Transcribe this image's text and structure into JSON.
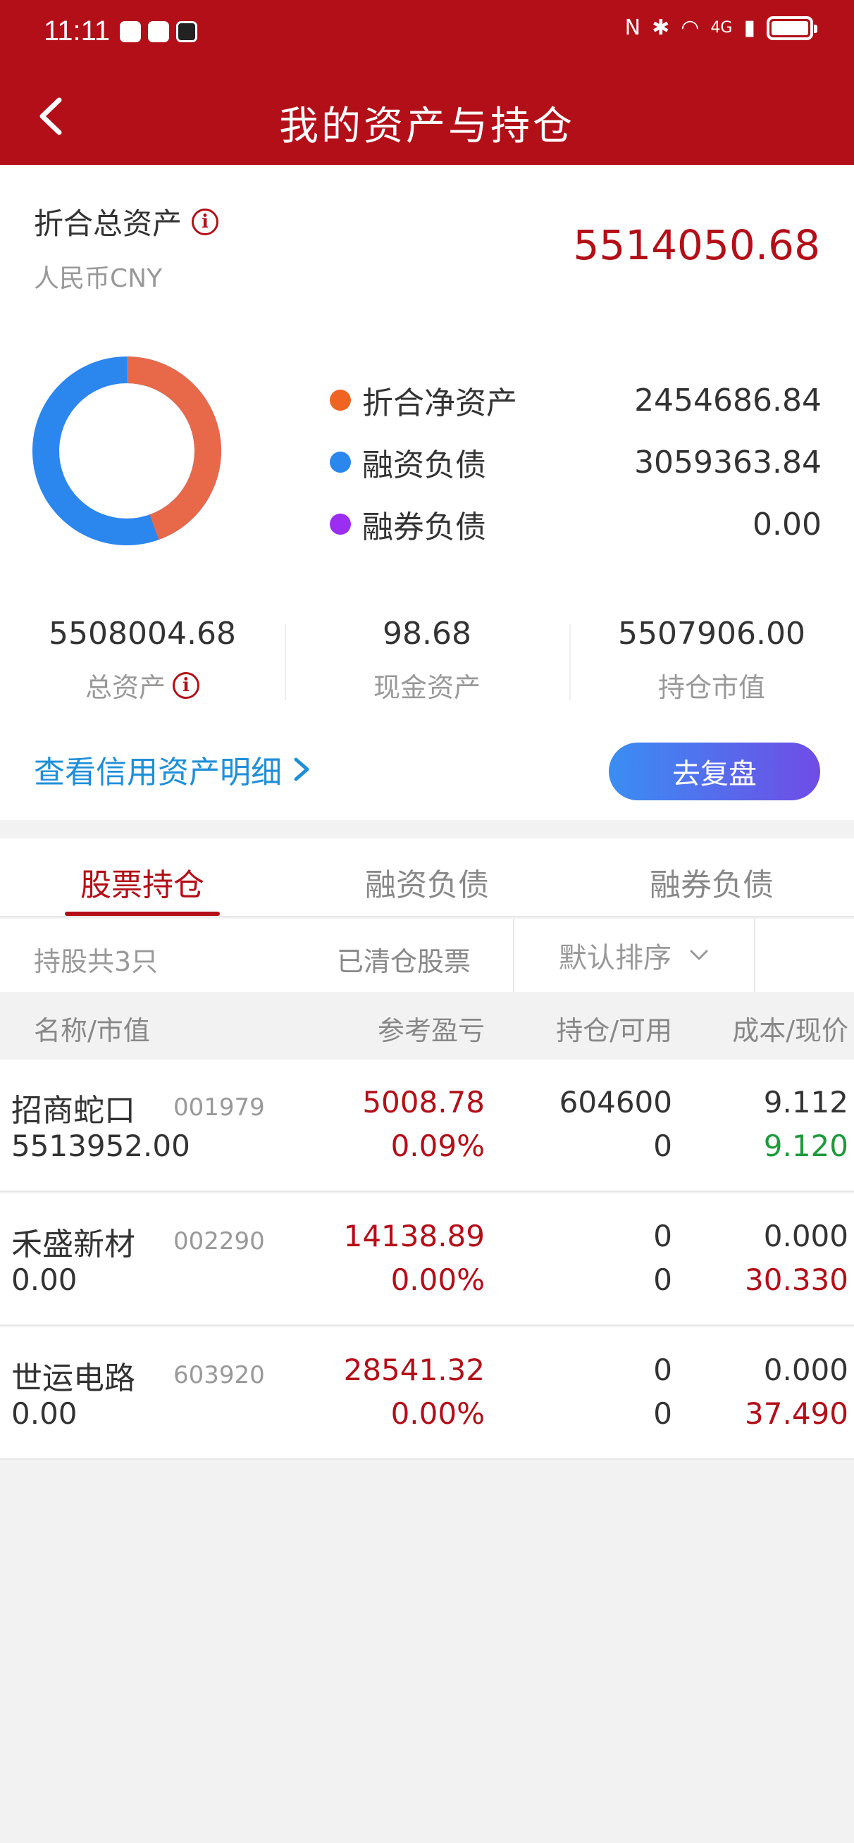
{
  "status_bar": {
    "time": "11:11",
    "network": "4G"
  },
  "header": {
    "title": "我的资产与持仓"
  },
  "summary": {
    "total_label": "折合总资产",
    "currency": "人民币CNY",
    "total_value": "5514050.68"
  },
  "composition": {
    "items": [
      {
        "label": "折合净资产",
        "value": "2454686.84",
        "color": "#f06423"
      },
      {
        "label": "融资负债",
        "value": "3059363.84",
        "color": "#2b86ee"
      },
      {
        "label": "融券负债",
        "value": "0.00",
        "color": "#9b2ef2"
      }
    ],
    "chart_colors": {
      "net": "#e8694a",
      "margin": "#2b86ee"
    },
    "net_fraction": 0.445
  },
  "stats": [
    {
      "value": "5508004.68",
      "label": "总资产"
    },
    {
      "value": "98.68",
      "label": "现金资产"
    },
    {
      "value": "5507906.00",
      "label": "持仓市值"
    }
  ],
  "actions": {
    "detail_link": "查看信用资产明细",
    "review_button": "去复盘"
  },
  "tabs": [
    "股票持仓",
    "融资负债",
    "融券负债"
  ],
  "filter": {
    "count": "持股共3只",
    "cleared": "已清仓股票",
    "sort": "默认排序"
  },
  "table": {
    "headers": [
      "名称/市值",
      "参考盈亏",
      "持仓/可用",
      "成本/现价"
    ],
    "rows": [
      {
        "name": "招商蛇口",
        "code": "001979",
        "market_value": "5513952.00",
        "pnl": "5008.78",
        "pnl_pct": "0.09%",
        "hold": "604600",
        "avail": "0",
        "cost": "9.112",
        "price": "9.120",
        "price_color": "#1e9a3a"
      },
      {
        "name": "禾盛新材",
        "code": "002290",
        "market_value": "0.00",
        "pnl": "14138.89",
        "pnl_pct": "0.00%",
        "hold": "0",
        "avail": "0",
        "cost": "0.000",
        "price": "30.330",
        "price_color": "#b30f18"
      },
      {
        "name": "世运电路",
        "code": "603920",
        "market_value": "0.00",
        "pnl": "28541.32",
        "pnl_pct": "0.00%",
        "hold": "0",
        "avail": "0",
        "cost": "0.000",
        "price": "37.490",
        "price_color": "#b30f18"
      }
    ]
  }
}
